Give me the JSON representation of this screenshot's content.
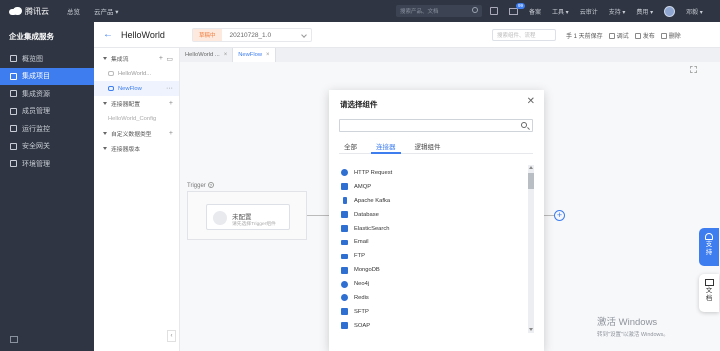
{
  "topbar": {
    "brand": "腾讯云",
    "nav": [
      "总览",
      "云产品 ▾"
    ],
    "search_placeholder": "搜索产品、文档",
    "mail_badge": "99",
    "right": [
      "备案",
      "工具 ▾",
      "云审计",
      "支持 ▾",
      "费用 ▾",
      "邓毅 ▾"
    ]
  },
  "sidebar": {
    "title": "企业集成服务",
    "items": [
      {
        "label": "概览图",
        "active": false
      },
      {
        "label": "集成项目",
        "active": true
      },
      {
        "label": "集成资源",
        "active": false
      },
      {
        "label": "成员管理",
        "active": false
      },
      {
        "label": "运行监控",
        "active": false
      },
      {
        "label": "安全网关",
        "active": false
      },
      {
        "label": "环境管理",
        "active": false
      }
    ]
  },
  "header": {
    "title": "HelloWorld",
    "status": "草稿中",
    "version": "20210728_1.0",
    "search_placeholder": "搜索组件、流程",
    "save_status": "手 1 天前保存",
    "actions": [
      "调试",
      "发布",
      "删除"
    ]
  },
  "tree": {
    "sections": [
      {
        "label": "集成流",
        "children": [
          "HelloWorld...",
          "NewFlow"
        ]
      },
      {
        "label": "连接器配置",
        "children": [
          "HelloWorld_Config"
        ]
      },
      {
        "label": "自定义数据类型",
        "children": []
      },
      {
        "label": "连接器版本",
        "children": []
      }
    ],
    "collapse": "‹"
  },
  "tabs": [
    {
      "label": "HelloWorld ...",
      "active": false
    },
    {
      "label": "NewFlow",
      "active": true
    }
  ],
  "canvas": {
    "trigger_label": "Trigger",
    "trigger_help": "?",
    "trigger_title": "未配置",
    "trigger_hint": "请先选择Trigger组件",
    "add": "+"
  },
  "modal": {
    "title": "请选择组件",
    "close": "✕",
    "tabs": [
      "全部",
      "连接器",
      "逻辑组件"
    ],
    "active_tab": 1,
    "items": [
      "HTTP Request",
      "AMQP",
      "Apache Kafka",
      "Database",
      "ElasticSearch",
      "Email",
      "FTP",
      "MongoDB",
      "Neo4j",
      "Redis",
      "SFTP",
      "SOAP"
    ]
  },
  "float": {
    "support": [
      "支",
      "持"
    ],
    "docs": [
      "文",
      "档"
    ]
  },
  "watermark": {
    "line1": "激活 Windows",
    "line2": "转到\"设置\"以激活 Windows。"
  },
  "colors": {
    "accent": "#3d7df0",
    "topbar": "#2f3542",
    "status": "#f07b3a"
  }
}
